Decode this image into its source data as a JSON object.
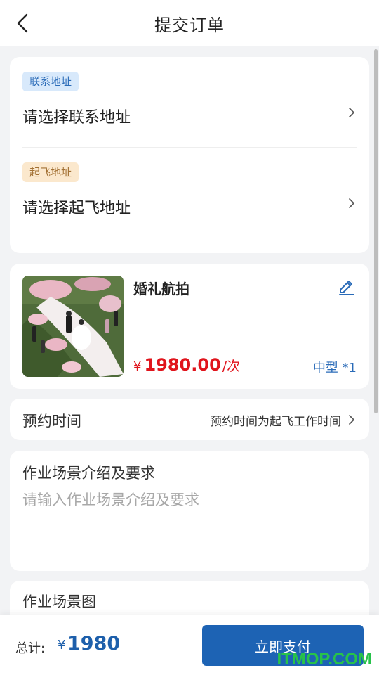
{
  "header": {
    "title": "提交订单",
    "back_icon": "chevron-left-icon"
  },
  "contact_address": {
    "tag": "联系地址",
    "placeholder": "请选择联系地址",
    "tag_bg": "#d8e9fb",
    "tag_color": "#2a6bb8"
  },
  "takeoff_address": {
    "tag": "起飞地址",
    "placeholder": "请选择起飞地址",
    "tag_bg": "#fbe8cd",
    "tag_color": "#a27033"
  },
  "product": {
    "name": "婚礼航拍",
    "currency": "¥",
    "price": "1980.00",
    "unit": "/次",
    "spec": "中型 *1",
    "image": "wedding-aerial-photo",
    "edit_icon": "pencil-edit-icon"
  },
  "appointment": {
    "label": "预约时间",
    "value": "预约时间为起飞工作时间"
  },
  "scene": {
    "title": "作业场景介绍及要求",
    "placeholder": "请输入作业场景介绍及要求"
  },
  "scene_photos": {
    "title": "作业场景图"
  },
  "footer": {
    "total_label": "总计:",
    "currency": "¥",
    "total": "1980",
    "pay_label": "立即支付"
  },
  "watermark": "ITMOP.COM",
  "colors": {
    "primary": "#1d63b4",
    "price_red": "#e0141c",
    "background": "#f2f3f5"
  }
}
